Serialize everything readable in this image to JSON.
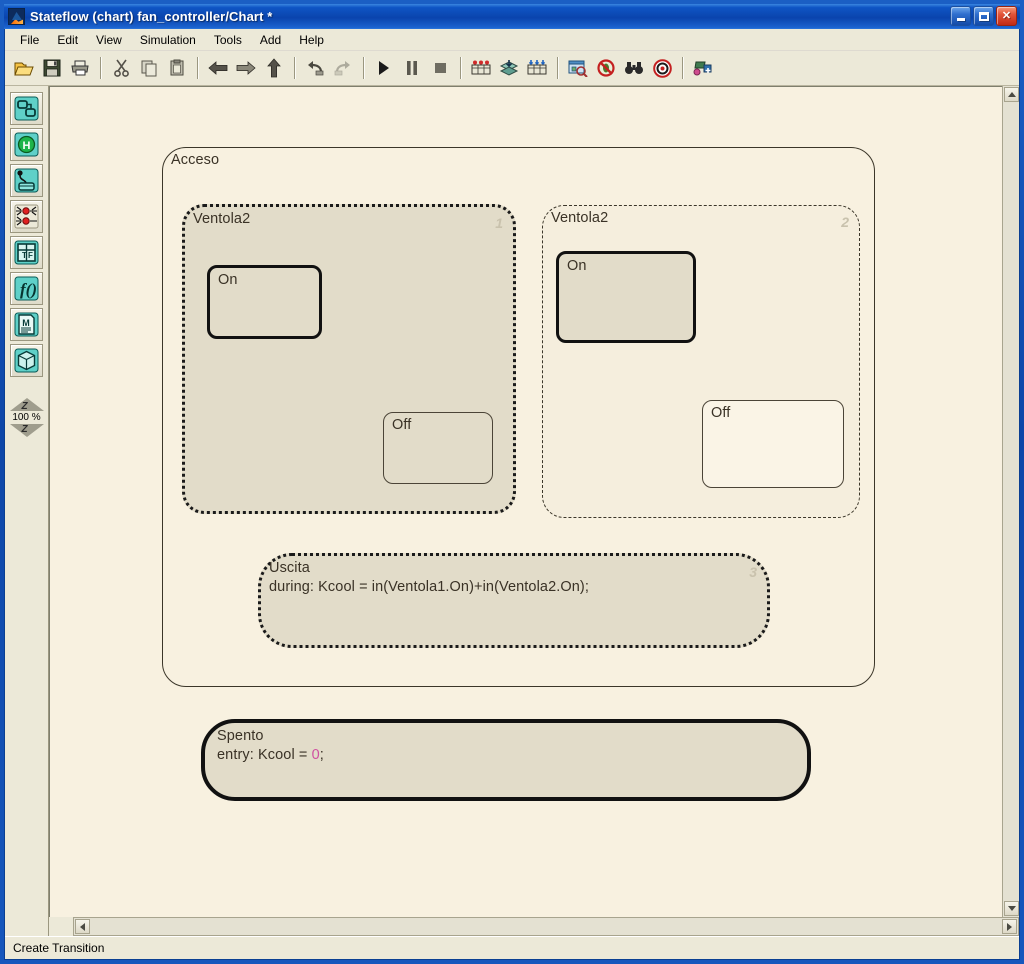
{
  "window": {
    "title": "Stateflow (chart) fan_controller/Chart *",
    "logo_icon": "matlab-logo-icon",
    "controls": [
      {
        "name": "minimize-button",
        "glyph": "minimize-icon"
      },
      {
        "name": "maximize-button",
        "glyph": "maximize-icon"
      },
      {
        "name": "close-button",
        "glyph": "close-icon",
        "label": "✕"
      }
    ]
  },
  "menubar": {
    "items": [
      {
        "label": "File"
      },
      {
        "label": "Edit"
      },
      {
        "label": "View"
      },
      {
        "label": "Simulation"
      },
      {
        "label": "Tools"
      },
      {
        "label": "Add"
      },
      {
        "label": "Help"
      }
    ]
  },
  "toolbar": {
    "groups": [
      {
        "buttons": [
          {
            "name": "open-button",
            "icon": "open-folder-icon"
          },
          {
            "name": "save-button",
            "icon": "floppy-save-icon"
          },
          {
            "name": "print-button",
            "icon": "printer-icon"
          }
        ]
      },
      {
        "buttons": [
          {
            "name": "cut-button",
            "icon": "scissors-icon"
          },
          {
            "name": "copy-button",
            "icon": "copy-icon"
          },
          {
            "name": "paste-button",
            "icon": "clipboard-paste-icon"
          }
        ]
      },
      {
        "buttons": [
          {
            "name": "back-button",
            "icon": "arrow-left-icon"
          },
          {
            "name": "forward-button",
            "icon": "arrow-right-icon"
          },
          {
            "name": "go-up-button",
            "icon": "arrow-up-icon"
          }
        ]
      },
      {
        "buttons": [
          {
            "name": "undo-button",
            "icon": "undo-icon"
          },
          {
            "name": "redo-button",
            "icon": "redo-icon"
          }
        ]
      },
      {
        "buttons": [
          {
            "name": "start-simulation-button",
            "icon": "play-icon"
          },
          {
            "name": "pause-simulation-button",
            "icon": "pause-icon"
          },
          {
            "name": "stop-simulation-button",
            "icon": "stop-icon"
          }
        ]
      },
      {
        "buttons": [
          {
            "name": "set-breakpoint-button",
            "icon": "chart-breakpoint-icon"
          },
          {
            "name": "build-button",
            "icon": "stack-build-icon"
          },
          {
            "name": "parse-button",
            "icon": "chart-parse-icon"
          }
        ]
      },
      {
        "buttons": [
          {
            "name": "explore-button",
            "icon": "model-explorer-icon"
          },
          {
            "name": "debug-button",
            "icon": "no-bug-icon"
          },
          {
            "name": "find-button",
            "icon": "binoculars-find-icon"
          },
          {
            "name": "target-button",
            "icon": "bullseye-target-icon"
          }
        ]
      },
      {
        "buttons": [
          {
            "name": "add-target-button",
            "icon": "add-target-icon"
          }
        ]
      }
    ]
  },
  "palette": {
    "tools": [
      {
        "name": "state-tool",
        "icon": "state-box-icon"
      },
      {
        "name": "history-junction-tool",
        "icon": "history-h-icon"
      },
      {
        "name": "default-transition-tool",
        "icon": "default-transition-icon"
      },
      {
        "name": "connective-junction-tool",
        "icon": "connective-junction-icon"
      },
      {
        "name": "truth-table-tool",
        "icon": "truth-table-icon"
      },
      {
        "name": "graphical-function-tool",
        "icon": "function-fx-icon"
      },
      {
        "name": "embedded-matlab-function-tool",
        "icon": "matlab-function-m-icon"
      },
      {
        "name": "box-tool",
        "icon": "box-cube-icon"
      }
    ],
    "zoom": {
      "in_icon": "zoom-in-triangle-icon",
      "out_icon": "zoom-out-triangle-icon",
      "letter": "Z",
      "level": "100 %"
    }
  },
  "scrollbars": {
    "vertical": {
      "up_icon": "scroll-up-arrow-icon",
      "down_icon": "scroll-down-arrow-icon"
    },
    "horizontal": {
      "left_icon": "scroll-left-arrow-icon",
      "right_icon": "scroll-right-arrow-icon"
    }
  },
  "statusbar": {
    "text": "Create Transition"
  },
  "chart": {
    "acceso": {
      "label": "Acceso"
    },
    "ventola_left": {
      "label": "Ventola2",
      "number": "1",
      "on": {
        "label": "On"
      },
      "off": {
        "label": "Off"
      }
    },
    "ventola_right": {
      "label": "Ventola2",
      "number": "2",
      "on": {
        "label": "On"
      },
      "off": {
        "label": "Off"
      }
    },
    "uscita": {
      "label": "Uscita",
      "action": "during: Kcool = in(Ventola1.On)+in(Ventola2.On);",
      "number": "3"
    },
    "spento": {
      "label": "Spento",
      "action_prefix": "entry: Kcool = ",
      "action_value": "0",
      "action_suffix": ";"
    }
  },
  "colors": {
    "canvas": "#f8f1e0",
    "state_fill": "#e2dcc9",
    "state_border": "#1a1a1a",
    "number_gray": "#c9c2ad",
    "numeric_literal": "#d050a0",
    "titlebar_blue": "#0f55c4"
  }
}
